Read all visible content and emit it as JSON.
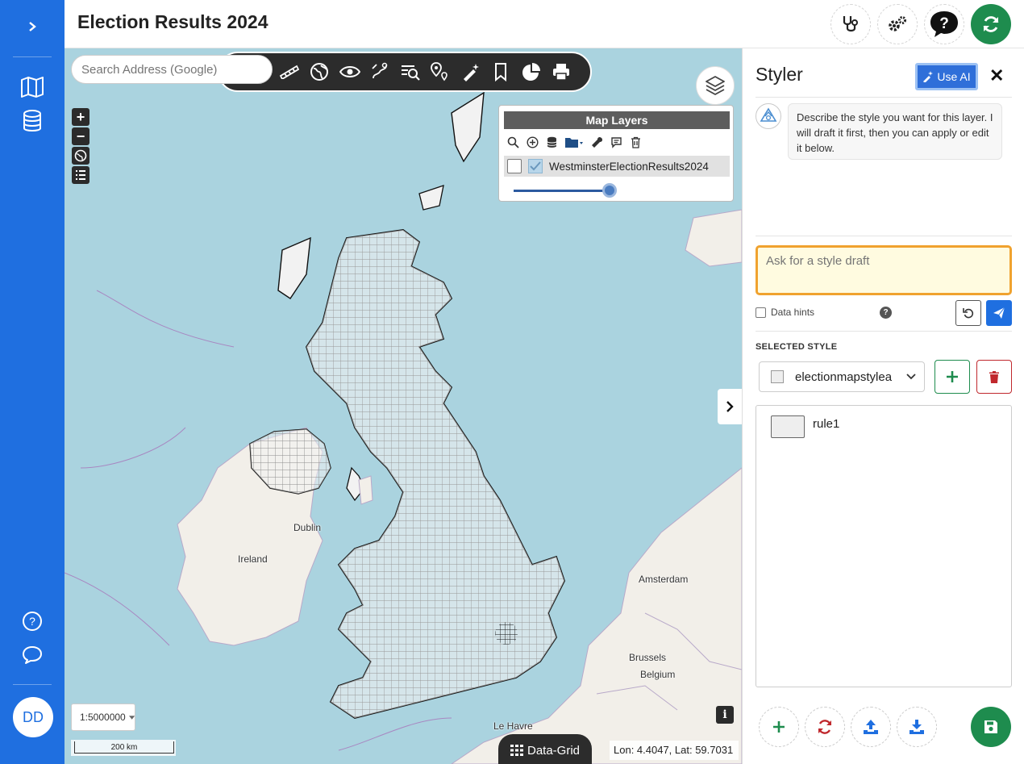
{
  "app": {
    "title": "Election Results 2024"
  },
  "sidebar": {
    "items": [
      {
        "name": "expand",
        "icon": "chevron-right-icon"
      },
      {
        "name": "maps",
        "icon": "map-icon"
      },
      {
        "name": "data",
        "icon": "database-icon"
      },
      {
        "name": "help",
        "icon": "help-circle-icon"
      },
      {
        "name": "chat",
        "icon": "chat-icon"
      }
    ],
    "avatar_initials": "DD"
  },
  "header_buttons": [
    {
      "name": "diagnostics",
      "icon": "stethoscope-icon"
    },
    {
      "name": "settings",
      "icon": "gears-icon"
    },
    {
      "name": "help",
      "icon": "question-bubble-icon"
    },
    {
      "name": "refresh",
      "icon": "refresh-icon",
      "color": "#1e8c4e"
    }
  ],
  "map": {
    "search_placeholder": "Search Address (Google)",
    "toolbar_icons": [
      "measure-icon",
      "globe-pin-icon",
      "eye-icon",
      "route-icon",
      "search-map-icon",
      "pins-icon",
      "magic-wand-icon",
      "bookmark-icon",
      "pie-chart-icon",
      "print-icon"
    ],
    "layers_panel": {
      "title": "Map Layers",
      "tools": [
        "search-icon",
        "add-circle-icon",
        "database-icon",
        "folder-icon",
        "wrench-icon",
        "comment-icon",
        "trash-icon"
      ],
      "layer_name": "WestminsterElectionResults2024",
      "layer_checked": true,
      "opacity": 1.0
    },
    "labels": {
      "dublin": "Dublin",
      "ireland": "Ireland",
      "amsterdam": "Amsterdam",
      "brussels": "Brussels",
      "belgium": "Belgium",
      "le_havre": "Le Havre"
    },
    "scale_select": "1:5000000",
    "scalebar_label": "200 km",
    "data_grid_label": "Data-Grid",
    "coords_text": "Lon: 4.4047, Lat: 59.7031",
    "colors": {
      "sea": "#aad3df",
      "land": "#f2efe9",
      "constituency": "#f2f2f2"
    }
  },
  "styler": {
    "title": "Styler",
    "use_ai_label": "Use AI",
    "close_label": "✕",
    "assistant_message": "Describe the style you want for this layer. I will draft it first, then you can apply or edit it below.",
    "ask_placeholder": "Ask for a style draft",
    "data_hints_label": "Data hints",
    "help_glyph": "?",
    "selected_style_label": "SELECTED STYLE",
    "selected_style_value": "electionmapstylea",
    "rules": [
      {
        "name": "rule1"
      }
    ],
    "bottom_buttons": [
      "add-icon",
      "sync-icon",
      "upload-icon",
      "download-icon",
      "save-icon"
    ],
    "colors": {
      "accent": "#1f6fe0",
      "green": "#1e8c4e",
      "red": "#c0282d",
      "ask_border": "#f0a22e"
    }
  }
}
